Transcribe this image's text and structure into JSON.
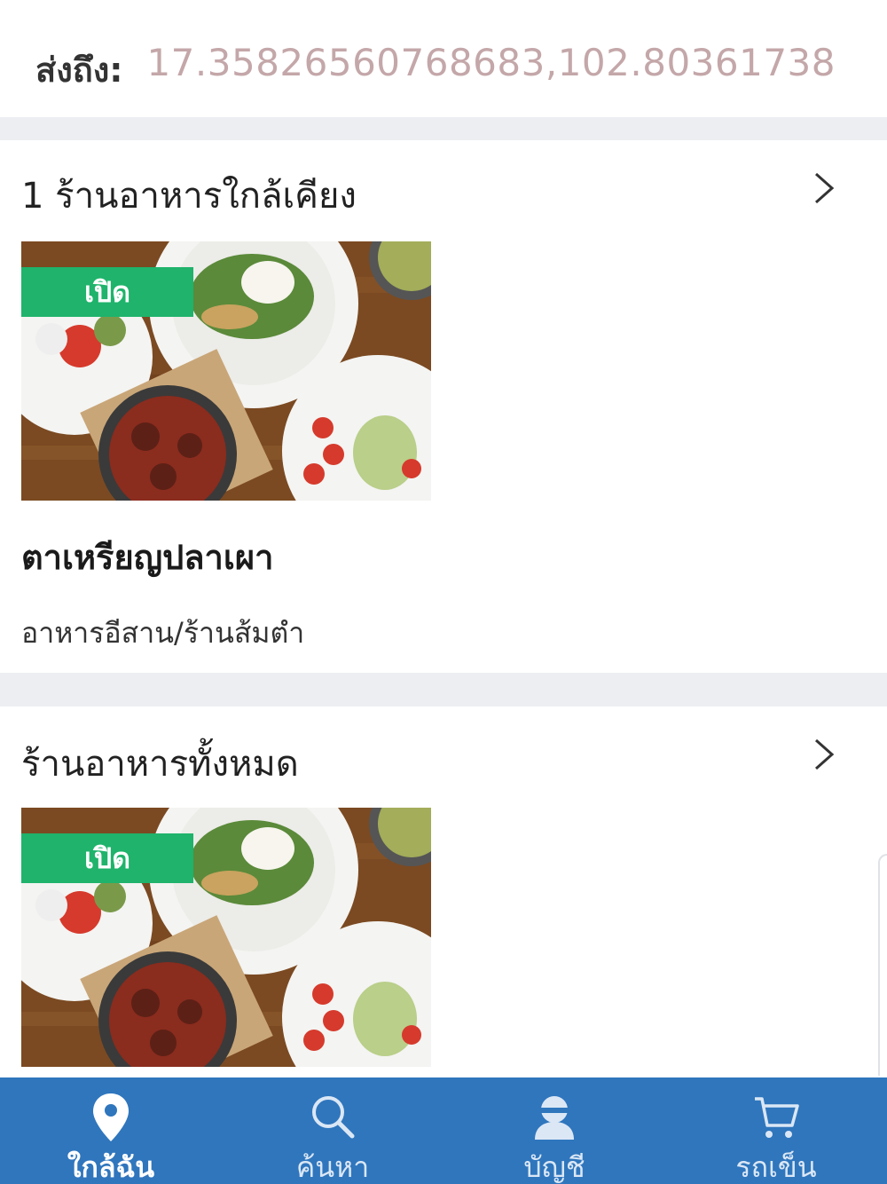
{
  "header": {
    "label": "ส่งถึง:",
    "coordinates": "17.35826560768683,102.80361738"
  },
  "nearby": {
    "title": "1 ร้านอาหารใกล้เคียง",
    "store": {
      "status": "เปิด",
      "name": "ตาเหรียญปลาเผา",
      "category": "อาหารอีสาน/ร้านส้มตำ"
    }
  },
  "all_stores": {
    "title": "ร้านอาหารทั้งหมด",
    "store": {
      "status": "เปิด"
    }
  },
  "tabbar": {
    "tabs": [
      {
        "label": "ใกล้ฉัน",
        "icon": "location-pin-icon",
        "active": true
      },
      {
        "label": "ค้นหา",
        "icon": "search-icon",
        "active": false
      },
      {
        "label": "บัญชี",
        "icon": "user-icon",
        "active": false
      },
      {
        "label": "รถเข็น",
        "icon": "cart-icon",
        "active": false
      }
    ]
  },
  "colors": {
    "tabbar_bg": "#2f76bd",
    "open_badge": "#1fb36b",
    "coordinates_text": "#c4a7a9",
    "divider": "#eceef1"
  }
}
